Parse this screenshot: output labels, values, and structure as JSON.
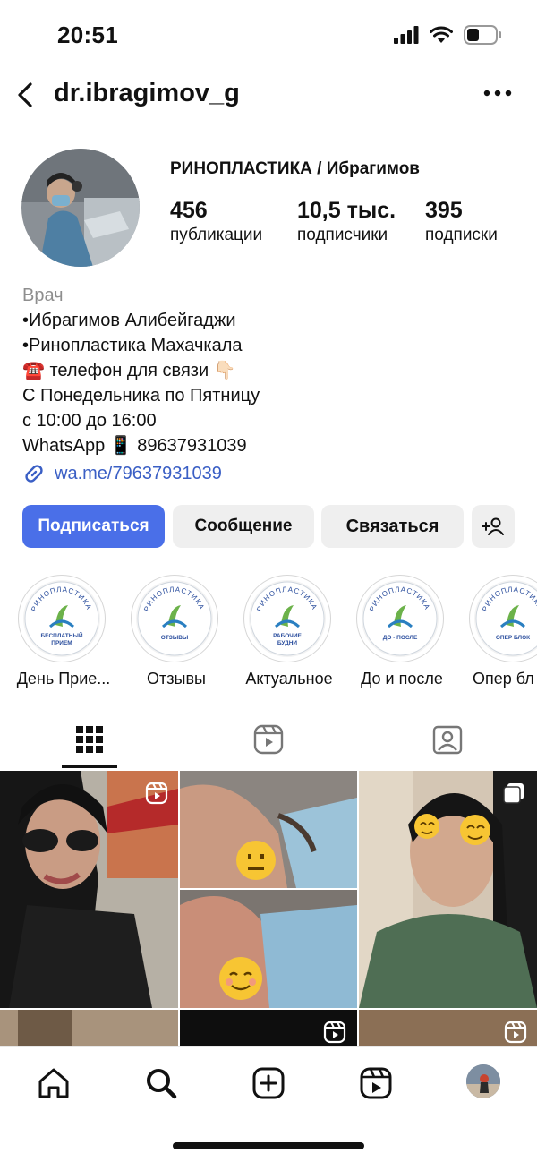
{
  "status_bar": {
    "time": "20:51"
  },
  "header": {
    "username": "dr.ibragimov_g"
  },
  "profile": {
    "display_name": "РИНОПЛАСТИКА / Ибрагимов",
    "stats": [
      {
        "count": "456",
        "label": "публикации"
      },
      {
        "count": "10,5 тыс.",
        "label": "подписчики"
      },
      {
        "count": "395",
        "label": "подписки"
      }
    ],
    "category": "Врач",
    "bio_lines": [
      "•Ибрагимов Алибейгаджи",
      "•Ринопластика Махачкала",
      "☎️ телефон для связи 👇🏻",
      "С Понедельника по Пятницу",
      "с 10:00 до 16:00",
      "WhatsApp 📱 89637931039"
    ],
    "link": "wa.me/79637931039"
  },
  "actions": {
    "follow": "Подписаться",
    "message": "Сообщение",
    "contact": "Связаться"
  },
  "highlights": [
    {
      "label": "День Прие...",
      "badge_line1": "БЕСПЛАТНЫЙ",
      "badge_line2": "ПРИЕМ"
    },
    {
      "label": "Отзывы",
      "badge_line1": "ОТЗЫВЫ",
      "badge_line2": ""
    },
    {
      "label": "Актуальное",
      "badge_line1": "РАБОЧИЕ",
      "badge_line2": "БУДНИ"
    },
    {
      "label": "До и после",
      "badge_line1": "ДО - ПОСЛЕ",
      "badge_line2": ""
    },
    {
      "label": "Опер бл",
      "badge_line1": "ОПЕР БЛОК",
      "badge_line2": ""
    }
  ],
  "highlight_ring_text": "РИНОПЛАСТИКА",
  "colors": {
    "accent": "#4a6fe8",
    "link": "#3a5fc5",
    "muted": "#8e8e8e",
    "chip": "#efefef"
  }
}
